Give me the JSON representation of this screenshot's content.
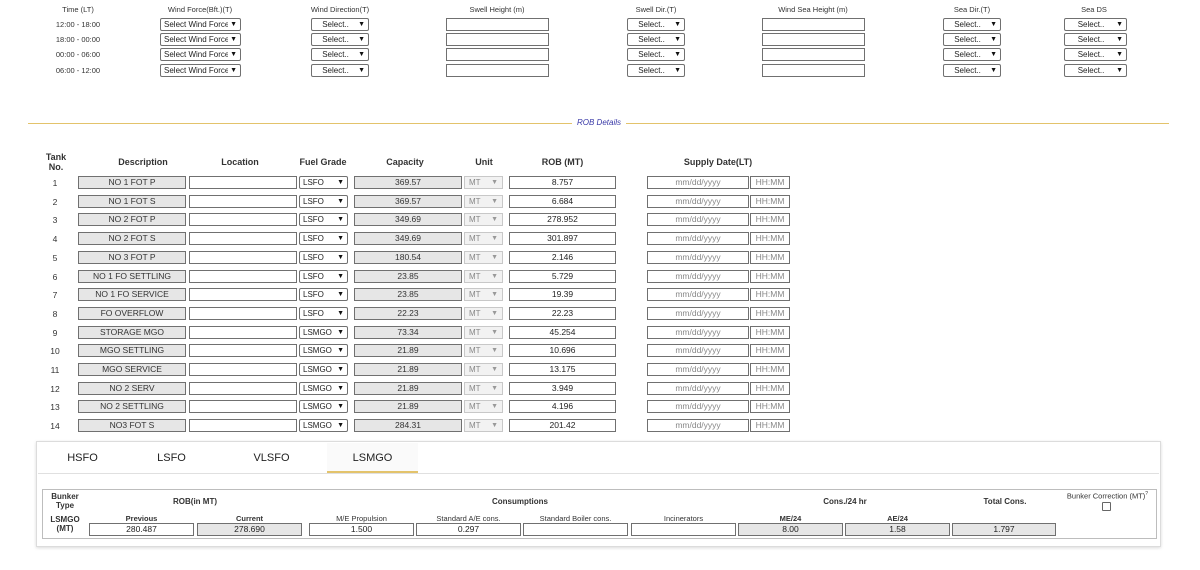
{
  "weather": {
    "headers": {
      "time": "Time (LT)",
      "wind_force": "Wind Force(Bft.)(T)",
      "wind_direction": "Wind Direction(T)",
      "swell_height": "Swell Height (m)",
      "swell_dir": "Swell Dir.(T)",
      "wind_sea_height": "Wind Sea Height (m)",
      "sea_dir": "Sea Dir.(T)",
      "sea_ds": "Sea DS"
    },
    "rows": [
      {
        "time": "12:00 - 18:00",
        "wind_force": "Select Wind Force",
        "wind_direction": "Select..",
        "swell_dir": "Select..",
        "sea_dir": "Select..",
        "sea_ds": "Select.."
      },
      {
        "time": "18:00 - 00:00",
        "wind_force": "Select Wind Force",
        "wind_direction": "Select..",
        "swell_dir": "Select..",
        "sea_dir": "Select..",
        "sea_ds": "Select.."
      },
      {
        "time": "00:00 - 06:00",
        "wind_force": "Select Wind Force",
        "wind_direction": "Select..",
        "swell_dir": "Select..",
        "sea_dir": "Select..",
        "sea_ds": "Select.."
      },
      {
        "time": "06:00 - 12:00",
        "wind_force": "Select Wind Force",
        "wind_direction": "Select..",
        "swell_dir": "Select..",
        "sea_dir": "Select..",
        "sea_ds": "Select.."
      }
    ]
  },
  "rob": {
    "section_title": "ROB Details",
    "headers": {
      "tank_no": "Tank No.",
      "description": "Description",
      "location": "Location",
      "fuel_grade": "Fuel Grade",
      "capacity": "Capacity",
      "unit": "Unit",
      "rob": "ROB (MT)",
      "supply_date": "Supply Date(LT)"
    },
    "date_placeholder": "mm/dd/yyyy",
    "time_placeholder": "HH:MM",
    "rows": [
      {
        "no": "1",
        "description": "NO 1 FOT  P",
        "location": "",
        "grade": "LSFO",
        "capacity": "369.57",
        "unit": "MT",
        "rob": "8.757"
      },
      {
        "no": "2",
        "description": "NO 1 FOT S",
        "location": "",
        "grade": "LSFO",
        "capacity": "369.57",
        "unit": "MT",
        "rob": "6.684"
      },
      {
        "no": "3",
        "description": "NO 2 FOT P",
        "location": "",
        "grade": "LSFO",
        "capacity": "349.69",
        "unit": "MT",
        "rob": "278.952"
      },
      {
        "no": "4",
        "description": "NO 2 FOT S",
        "location": "",
        "grade": "LSFO",
        "capacity": "349.69",
        "unit": "MT",
        "rob": "301.897"
      },
      {
        "no": "5",
        "description": "NO 3 FOT P",
        "location": "",
        "grade": "LSFO",
        "capacity": "180.54",
        "unit": "MT",
        "rob": "2.146"
      },
      {
        "no": "6",
        "description": "NO 1 FO SETTLING",
        "location": "",
        "grade": "LSFO",
        "capacity": "23.85",
        "unit": "MT",
        "rob": "5.729"
      },
      {
        "no": "7",
        "description": "NO 1 FO SERVICE",
        "location": "",
        "grade": "LSFO",
        "capacity": "23.85",
        "unit": "MT",
        "rob": "19.39"
      },
      {
        "no": "8",
        "description": "FO OVERFLOW",
        "location": "",
        "grade": "LSFO",
        "capacity": "22.23",
        "unit": "MT",
        "rob": "22.23"
      },
      {
        "no": "9",
        "description": "STORAGE MGO",
        "location": "",
        "grade": "LSMGO",
        "capacity": "73.34",
        "unit": "MT",
        "rob": "45.254"
      },
      {
        "no": "10",
        "description": "MGO SETTLING",
        "location": "",
        "grade": "LSMGO",
        "capacity": "21.89",
        "unit": "MT",
        "rob": "10.696"
      },
      {
        "no": "11",
        "description": "MGO SERVICE",
        "location": "",
        "grade": "LSMGO",
        "capacity": "21.89",
        "unit": "MT",
        "rob": "13.175"
      },
      {
        "no": "12",
        "description": "NO 2 SERV",
        "location": "",
        "grade": "LSMGO",
        "capacity": "21.89",
        "unit": "MT",
        "rob": "3.949"
      },
      {
        "no": "13",
        "description": "NO 2 SETTLING",
        "location": "",
        "grade": "LSMGO",
        "capacity": "21.89",
        "unit": "MT",
        "rob": "4.196"
      },
      {
        "no": "14",
        "description": "NO3 FOT S",
        "location": "",
        "grade": "LSMGO",
        "capacity": "284.31",
        "unit": "MT",
        "rob": "201.42"
      }
    ]
  },
  "fuel_tabs": {
    "items": [
      "HSFO",
      "LSFO",
      "VLSFO",
      "LSMGO"
    ],
    "active": "LSMGO"
  },
  "bunker": {
    "bunker_type_label": "Bunker Type",
    "type_value": "LSMGO (MT)",
    "rob_label": "ROB(in MT)",
    "consumptions_label": "Consumptions",
    "cons24_label": "Cons./24 hr",
    "total_label": "Total Cons.",
    "correction_label": "Bunker Correction (MT)",
    "help_mark": "?",
    "previous_label": "Previous",
    "current_label": "Current",
    "me_propulsion_label": "M/E Propulsion",
    "std_ae_label": "Standard A/E cons.",
    "std_boiler_label": "Standard Boiler cons.",
    "incinerators_label": "Incinerators",
    "me24_label": "ME/24",
    "ae24_label": "AE/24",
    "previous": "280.487",
    "current": "278.690",
    "me_propulsion": "1.500",
    "std_ae": "0.297",
    "std_boiler": "",
    "incinerators": "",
    "me24": "8.00",
    "ae24": "1.58",
    "total": "1.797",
    "correction_checked": false
  },
  "colors": {
    "accent": "#e3c36b",
    "section_title": "#3a3aa8",
    "readonly_bg": "#e6e6e6"
  }
}
